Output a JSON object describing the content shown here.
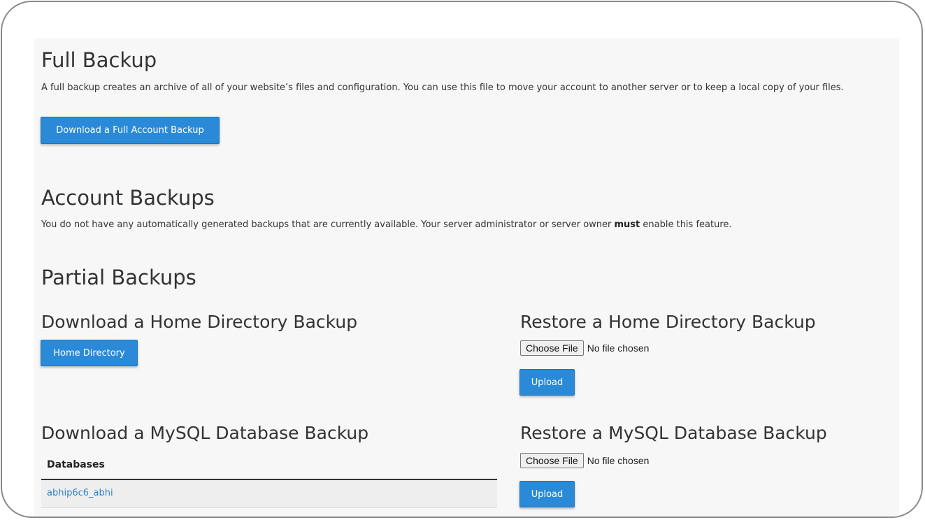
{
  "full_backup": {
    "title": "Full Backup",
    "description": "A full backup creates an archive of all of your website’s files and configuration. You can use this file to move your account to another server or to keep a local copy of your files.",
    "button_label": "Download a Full Account Backup"
  },
  "account_backups": {
    "title": "Account Backups",
    "description_before": "You do not have any automatically generated backups that are currently available. Your server administrator or server owner ",
    "description_emphasis": "must",
    "description_after": " enable this feature."
  },
  "partial_backups": {
    "title": "Partial Backups",
    "home_download": {
      "title": "Download a Home Directory Backup",
      "button_label": "Home Directory"
    },
    "home_restore": {
      "title": "Restore a Home Directory Backup",
      "choose_label": "Choose File",
      "file_status": "No file chosen",
      "upload_label": "Upload"
    },
    "mysql_download": {
      "title": "Download a MySQL Database Backup",
      "table_header": "Databases",
      "databases": [
        "abhip6c6_abhi"
      ]
    },
    "mysql_restore": {
      "title": "Restore a MySQL Database Backup",
      "choose_label": "Choose File",
      "file_status": "No file chosen",
      "upload_label": "Upload"
    }
  },
  "colors": {
    "button": "#2b8ad8",
    "link": "#2b7fc7",
    "panel_background": "#f7f7f7"
  }
}
